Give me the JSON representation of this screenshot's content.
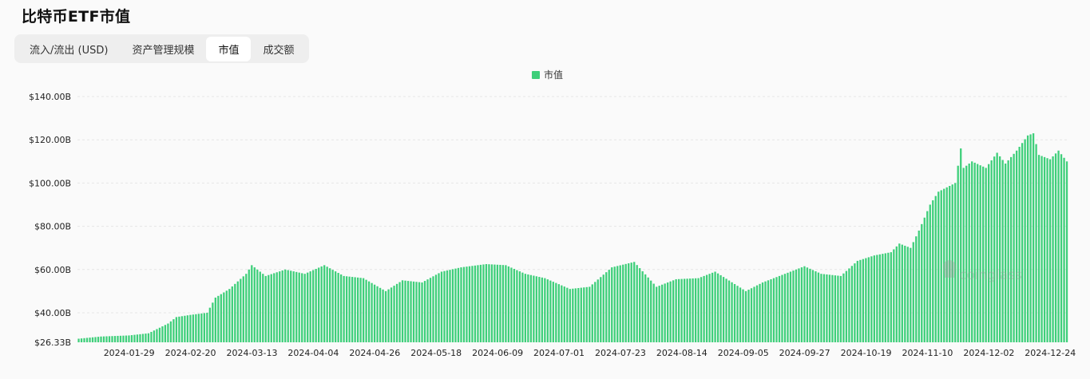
{
  "title": "比特币ETF市值",
  "tabs": [
    {
      "label": "流入/流出 (USD)",
      "active": false
    },
    {
      "label": "资产管理规模",
      "active": false
    },
    {
      "label": "市值",
      "active": true
    },
    {
      "label": "成交额",
      "active": false
    }
  ],
  "watermark": "coinglass",
  "colors": {
    "bar": "#3ecf7a",
    "grid": "#e5e5e5",
    "text": "#222222"
  },
  "chart_data": {
    "type": "bar",
    "legend": {
      "label": "市值",
      "position": "top-center"
    },
    "ylim": [
      26.33,
      140
    ],
    "y_ticks": [
      26.33,
      40,
      60,
      80,
      100,
      120,
      140
    ],
    "y_tick_labels": [
      "$26.33B",
      "$40.00B",
      "$60.00B",
      "$80.00B",
      "$100.00B",
      "$120.00B",
      "$140.00B"
    ],
    "x_tick_labels": [
      "2024-01-29",
      "2024-02-20",
      "2024-03-13",
      "2024-04-04",
      "2024-04-26",
      "2024-05-18",
      "2024-06-09",
      "2024-07-01",
      "2024-07-23",
      "2024-08-14",
      "2024-09-05",
      "2024-09-27",
      "2024-10-19",
      "2024-11-10",
      "2024-12-02",
      "2024-12-24"
    ],
    "grid": true,
    "series": [
      {
        "name": "市值",
        "anchors": [
          [
            "2024-01-11",
            28.0
          ],
          [
            "2024-01-19",
            29.0
          ],
          [
            "2024-01-29",
            29.5
          ],
          [
            "2024-02-05",
            30.5
          ],
          [
            "2024-02-12",
            35.0
          ],
          [
            "2024-02-15",
            38.0
          ],
          [
            "2024-02-20",
            39.0
          ],
          [
            "2024-02-26",
            40.0
          ],
          [
            "2024-02-29",
            47.0
          ],
          [
            "2024-03-05",
            51.0
          ],
          [
            "2024-03-11",
            58.0
          ],
          [
            "2024-03-13",
            62.0
          ],
          [
            "2024-03-18",
            57.0
          ],
          [
            "2024-03-25",
            60.0
          ],
          [
            "2024-04-01",
            58.0
          ],
          [
            "2024-04-08",
            62.0
          ],
          [
            "2024-04-15",
            57.0
          ],
          [
            "2024-04-22",
            56.0
          ],
          [
            "2024-04-30",
            50.0
          ],
          [
            "2024-05-06",
            55.0
          ],
          [
            "2024-05-13",
            54.0
          ],
          [
            "2024-05-20",
            59.0
          ],
          [
            "2024-05-27",
            61.0
          ],
          [
            "2024-06-05",
            62.5
          ],
          [
            "2024-06-12",
            62.0
          ],
          [
            "2024-06-19",
            58.0
          ],
          [
            "2024-06-26",
            56.0
          ],
          [
            "2024-07-05",
            51.0
          ],
          [
            "2024-07-12",
            52.0
          ],
          [
            "2024-07-20",
            61.0
          ],
          [
            "2024-07-28",
            63.5
          ],
          [
            "2024-08-05",
            52.0
          ],
          [
            "2024-08-12",
            55.5
          ],
          [
            "2024-08-20",
            56.0
          ],
          [
            "2024-08-26",
            59.0
          ],
          [
            "2024-09-06",
            50.0
          ],
          [
            "2024-09-12",
            54.0
          ],
          [
            "2024-09-20",
            58.0
          ],
          [
            "2024-09-27",
            61.5
          ],
          [
            "2024-10-03",
            58.0
          ],
          [
            "2024-10-10",
            57.0
          ],
          [
            "2024-10-16",
            64.0
          ],
          [
            "2024-10-22",
            66.5
          ],
          [
            "2024-10-28",
            68.0
          ],
          [
            "2024-10-31",
            72.0
          ],
          [
            "2024-11-04",
            70.0
          ],
          [
            "2024-11-07",
            78.0
          ],
          [
            "2024-11-11",
            90.0
          ],
          [
            "2024-11-14",
            96.0
          ],
          [
            "2024-11-20",
            100.0
          ],
          [
            "2024-11-22",
            116.0
          ],
          [
            "2024-11-23",
            107.0
          ],
          [
            "2024-11-26",
            110.0
          ],
          [
            "2024-12-01",
            107.0
          ],
          [
            "2024-12-05",
            114.0
          ],
          [
            "2024-12-08",
            109.0
          ],
          [
            "2024-12-12",
            115.0
          ],
          [
            "2024-12-16",
            122.0
          ],
          [
            "2024-12-18",
            123.0
          ],
          [
            "2024-12-20",
            113.0
          ],
          [
            "2024-12-24",
            111.0
          ],
          [
            "2024-12-27",
            115.0
          ],
          [
            "2024-12-30",
            110.0
          ]
        ]
      }
    ]
  }
}
